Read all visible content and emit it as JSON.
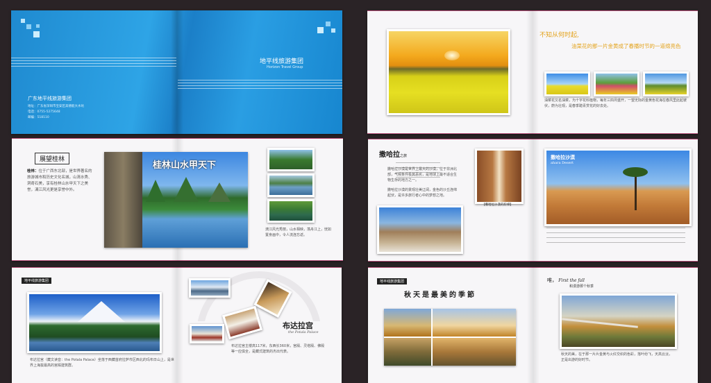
{
  "cover": {
    "company": "地平线旅游集团",
    "company_en": "Horizon Travel Group",
    "full_name": "广东地平线旅游集团",
    "address": "地址：广东省深圳市宝安区高德能大水坑",
    "phone": "电话：0755-5275648",
    "postcode": "邮编：518110"
  },
  "rapeseed": {
    "quote_line1": "不知从何时起,",
    "quote_line2": "油菜花的那一片金黄成了春播时节的一道绵亮色",
    "body": "油菜花又名油菜，为十字花科植物，每年三四月盛开，一望无际的金黄色花海在春风里此起彼伏，蔚为壮观，是春季踏青赏花的好去处。"
  },
  "guilin": {
    "title": "展望桂林",
    "headline": "桂林山水甲天下",
    "lead": "桂林：",
    "body": "位于广西东北部，是世界著名的旅游城市和历史文化名城，山清水秀、洞奇石美，享有桂林山水甲天下之美誉，漓江风光更是享誉中外。",
    "caption": "漓江风光秀丽，山水相映，荡舟江上，恍如置身画中，令人流连忘返。"
  },
  "sahara": {
    "title": "撒哈拉",
    "title_tail": "之旅",
    "title_en": "ahara Desert",
    "photo_label": "撒哈拉沙漠",
    "caption": "【撒哈拉沙漠的阶梯】",
    "body1": "撒哈拉沙漠是世界上最大的沙漠，位于非洲北部，气候条件极其恶劣，是地球上最不适合生物生存的地方之一。",
    "body2": "撒哈拉沙漠的景观壮美辽阔，金色的沙丘连绵起伏，是许多旅行者心中的梦想之地。"
  },
  "potala": {
    "tag": "地平线旅游集团",
    "title": "布达拉宫",
    "title_en": "the Potala Palace",
    "body1": "布达拉宫（藏文读音：the Potala Palace）坐落于西藏首府拉萨市区西北的玛布日山上，是世界上海拔最高的宫殿建筑群。",
    "body2": "布达拉宫主楼高117米，东西长360米，宫殿、灵塔殿、佛殿等一应俱全，是藏式建筑的杰出代表。"
  },
  "autumn": {
    "tag": "地平线旅游集团",
    "headline": "秋天是最美的季節",
    "heading_prefix": "唯，",
    "heading_en": "First the fall",
    "heading_sub": "和漫游那个秋季",
    "body": "秋天的美，在于那一片片金黄与火红交织的色彩，落叶纷飞，天高云淡，正是出游的好时节。"
  },
  "colors": {
    "cover_blue": "#1a8fd6",
    "gold": "#e3a21a",
    "rule_pink": "#b8507a"
  }
}
